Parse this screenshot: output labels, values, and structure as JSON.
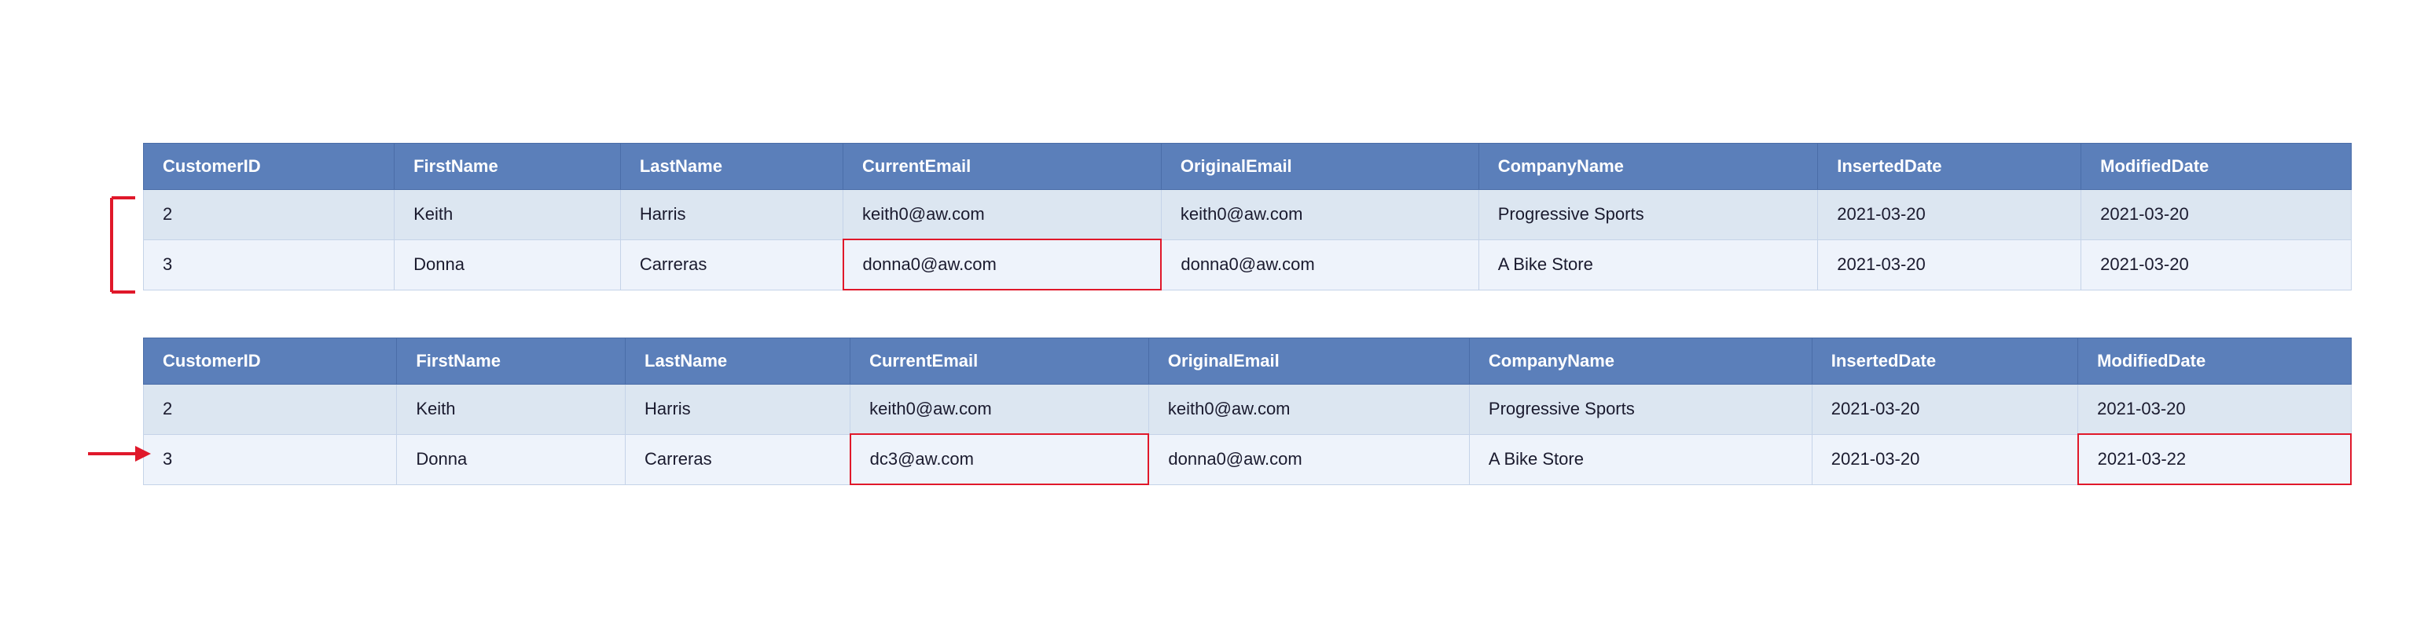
{
  "tables": [
    {
      "id": "table-top",
      "columns": [
        "CustomerID",
        "FirstName",
        "LastName",
        "CurrentEmail",
        "OriginalEmail",
        "CompanyName",
        "InsertedDate",
        "ModifiedDate"
      ],
      "rows": [
        {
          "id": "2",
          "firstName": "Keith",
          "lastName": "Harris",
          "currentEmail": "keith0@aw.com",
          "originalEmail": "keith0@aw.com",
          "companyName": "Progressive Sports",
          "insertedDate": "2021-03-20",
          "modifiedDate": "2021-03-20",
          "highlightCurrentEmail": false,
          "highlightModifiedDate": false
        },
        {
          "id": "3",
          "firstName": "Donna",
          "lastName": "Carreras",
          "currentEmail": "donna0@aw.com",
          "originalEmail": "donna0@aw.com",
          "companyName": "A Bike Store",
          "insertedDate": "2021-03-20",
          "modifiedDate": "2021-03-20",
          "highlightCurrentEmail": true,
          "highlightModifiedDate": false
        }
      ]
    },
    {
      "id": "table-bottom",
      "columns": [
        "CustomerID",
        "FirstName",
        "LastName",
        "CurrentEmail",
        "OriginalEmail",
        "CompanyName",
        "InsertedDate",
        "ModifiedDate"
      ],
      "rows": [
        {
          "id": "2",
          "firstName": "Keith",
          "lastName": "Harris",
          "currentEmail": "keith0@aw.com",
          "originalEmail": "keith0@aw.com",
          "companyName": "Progressive Sports",
          "insertedDate": "2021-03-20",
          "modifiedDate": "2021-03-20",
          "highlightCurrentEmail": false,
          "highlightModifiedDate": false
        },
        {
          "id": "3",
          "firstName": "Donna",
          "lastName": "Carreras",
          "currentEmail": "dc3@aw.com",
          "originalEmail": "donna0@aw.com",
          "companyName": "A Bike Store",
          "insertedDate": "2021-03-20",
          "modifiedDate": "2021-03-22",
          "highlightCurrentEmail": true,
          "highlightModifiedDate": true
        }
      ]
    }
  ],
  "arrowColor": "#e0182a"
}
